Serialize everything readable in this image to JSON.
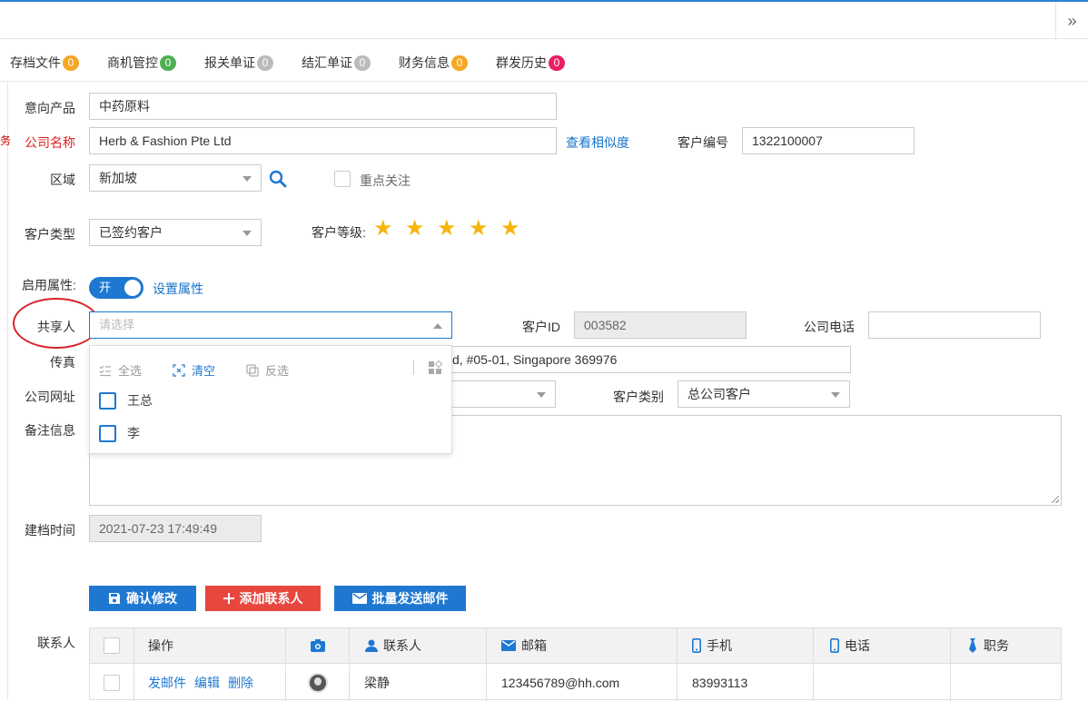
{
  "topbar": {
    "collapse_icon": "»"
  },
  "tabs": [
    {
      "label": "存档文件",
      "count": "0",
      "color": "#f5a623"
    },
    {
      "label": "商机管控",
      "count": "0",
      "color": "#4caf50"
    },
    {
      "label": "报关单证",
      "count": "0",
      "color": "#bbbbbb"
    },
    {
      "label": "结汇单证",
      "count": "0",
      "color": "#bbbbbb"
    },
    {
      "label": "财务信息",
      "count": "0",
      "color": "#f5a623"
    },
    {
      "label": "群发历史",
      "count": "0",
      "color": "#e91e63"
    }
  ],
  "stray_glyph": "务",
  "form": {
    "intended_product": {
      "label": "意向产品",
      "value": "中药原料"
    },
    "company_name": {
      "label": "公司名称",
      "value": "Herb & Fashion Pte Ltd",
      "link": "查看相似度"
    },
    "customer_no": {
      "label": "客户编号",
      "value": "1322100007"
    },
    "region": {
      "label": "区域",
      "value": "新加坡"
    },
    "key_follow": {
      "label": "重点关注",
      "checked": false
    },
    "customer_type": {
      "label": "客户类型",
      "value": "已签约客户"
    },
    "customer_level": {
      "label": "客户等级:",
      "stars": 5
    },
    "enable_attr": {
      "label": "启用属性:",
      "toggle": "开",
      "link": "设置属性"
    },
    "sharer": {
      "label": "共享人",
      "placeholder": "请选择"
    },
    "customer_id": {
      "label": "客户ID",
      "value": "003582"
    },
    "company_phone": {
      "label": "公司电话",
      "value": ""
    },
    "fax": {
      "label": "传真"
    },
    "address_visible": "d, #05-01, Singapore 369976",
    "website": {
      "label": "公司网址"
    },
    "customer_category": {
      "label": "客户类别",
      "value": "总公司客户"
    },
    "remark": {
      "label": "备注信息"
    },
    "created_time": {
      "label": "建档时间",
      "value": "2021-07-23 17:49:49"
    }
  },
  "sharer_dropdown": {
    "select_all": "全选",
    "clear": "清空",
    "invert": "反选",
    "options": [
      "王总",
      "李"
    ]
  },
  "actions": {
    "confirm": "确认修改",
    "add_contact": "添加联系人",
    "bulk_email": "批量发送邮件"
  },
  "contacts": {
    "label": "联系人",
    "headers": {
      "ops": "操作",
      "contact": "联系人",
      "email": "邮箱",
      "mobile": "手机",
      "phone": "电话",
      "title": "职务"
    },
    "rows": [
      {
        "send": "发邮件",
        "edit": "编辑",
        "delete": "删除",
        "name": "梁静",
        "email": "123456789@hh.com",
        "mobile": "83993113",
        "phone": "",
        "title": ""
      }
    ]
  },
  "colors": {
    "primary": "#1e78d2",
    "danger": "#e8473f",
    "star": "#f5b50a",
    "annotation": "#d8232a"
  }
}
